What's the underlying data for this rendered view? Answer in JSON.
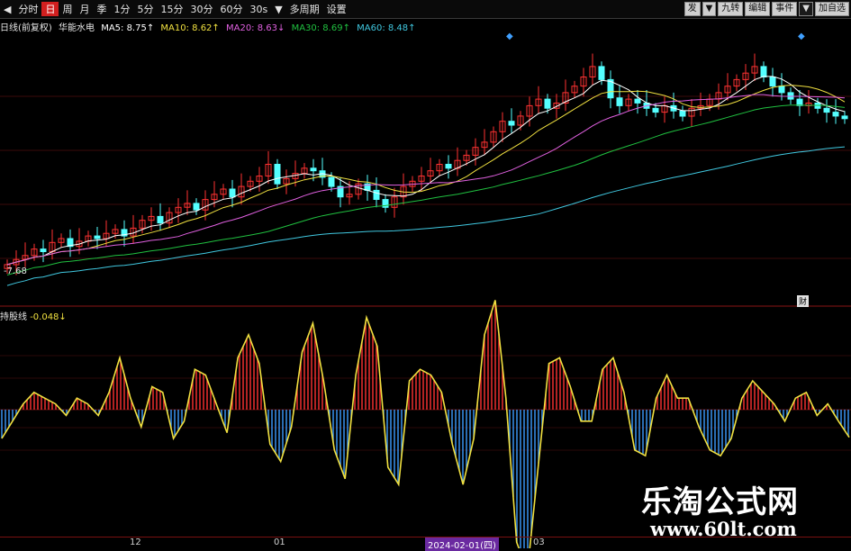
{
  "toolbar": {
    "items": [
      "分时",
      "日",
      "周",
      "月",
      "季",
      "1分",
      "5分",
      "15分",
      "30分",
      "60分",
      "30s",
      "▼",
      "多周期",
      "设置"
    ],
    "active_index": 1,
    "right": [
      "发",
      "▼",
      "九转",
      "编辑",
      "事件",
      "▼",
      "加自选"
    ]
  },
  "legend": {
    "title": "日线(前复权)",
    "label2": "华能水电",
    "ma5": "MA5: 8.75↑",
    "ma10": "MA10: 8.62↑",
    "ma20": "MA20: 8.63↓",
    "ma30": "MA30: 8.69↑",
    "ma60": "MA60: 8.48↑"
  },
  "price_tag": "-7.68",
  "small_box": "财",
  "indicator": {
    "name": "持股线",
    "value": "-0.048↓"
  },
  "dates": {
    "d1": "12",
    "d2": "01",
    "d3": "2024-02-01(四)",
    "d4": "03"
  },
  "watermark": {
    "line1": "乐淘公式网",
    "line2": "www.60lt.com"
  },
  "colors": {
    "up": "#ff3232",
    "down": "#54ffff",
    "ma5": "#ffffff",
    "ma10": "#f0e040",
    "ma20": "#e060e0",
    "ma30": "#20c040",
    "ma60": "#40c8e0"
  },
  "chart_data": {
    "type": "candlestick",
    "closes": [
      7.68,
      7.72,
      7.75,
      7.8,
      7.78,
      7.85,
      7.88,
      7.82,
      7.86,
      7.9,
      7.88,
      7.92,
      7.95,
      7.9,
      7.96,
      8.02,
      8.05,
      8.0,
      8.08,
      8.12,
      8.15,
      8.1,
      8.18,
      8.22,
      8.26,
      8.2,
      8.28,
      8.32,
      8.36,
      8.45,
      8.3,
      8.34,
      8.38,
      8.42,
      8.4,
      8.35,
      8.28,
      8.2,
      8.22,
      8.3,
      8.25,
      8.18,
      8.12,
      8.2,
      8.28,
      8.32,
      8.36,
      8.4,
      8.45,
      8.42,
      8.48,
      8.52,
      8.58,
      8.62,
      8.7,
      8.78,
      8.75,
      8.82,
      8.9,
      8.95,
      8.88,
      8.92,
      9.0,
      9.05,
      9.12,
      9.2,
      9.1,
      8.96,
      8.9,
      8.95,
      8.92,
      8.88,
      8.85,
      8.9,
      8.86,
      8.82,
      8.88,
      8.9,
      8.95,
      9.0,
      9.05,
      9.1,
      9.15,
      9.2,
      9.12,
      9.05,
      9.0,
      8.95,
      8.9,
      8.92,
      8.88,
      8.85,
      8.82,
      8.8
    ],
    "indicator": [
      -0.05,
      -0.02,
      0.01,
      0.03,
      0.02,
      0.01,
      -0.01,
      0.02,
      0.01,
      -0.01,
      0.03,
      0.09,
      0.02,
      -0.03,
      0.04,
      0.03,
      -0.05,
      -0.02,
      0.07,
      0.06,
      0.01,
      -0.04,
      0.09,
      0.13,
      0.08,
      -0.06,
      -0.09,
      -0.03,
      0.1,
      0.15,
      0.05,
      -0.07,
      -0.12,
      0.06,
      0.16,
      0.11,
      -0.1,
      -0.13,
      0.05,
      0.07,
      0.06,
      0.03,
      -0.06,
      -0.13,
      -0.05,
      0.13,
      0.19,
      0.02,
      -0.23,
      -0.28,
      -0.1,
      0.08,
      0.09,
      0.04,
      -0.02,
      -0.02,
      0.07,
      0.09,
      0.03,
      -0.07,
      -0.08,
      0.02,
      0.06,
      0.02,
      0.02,
      -0.03,
      -0.07,
      -0.08,
      -0.05,
      0.02,
      0.05,
      0.03,
      0.01,
      -0.02,
      0.02,
      0.03,
      -0.01,
      0.01,
      -0.02,
      -0.048
    ],
    "ylim": [
      7.5,
      9.4
    ]
  }
}
